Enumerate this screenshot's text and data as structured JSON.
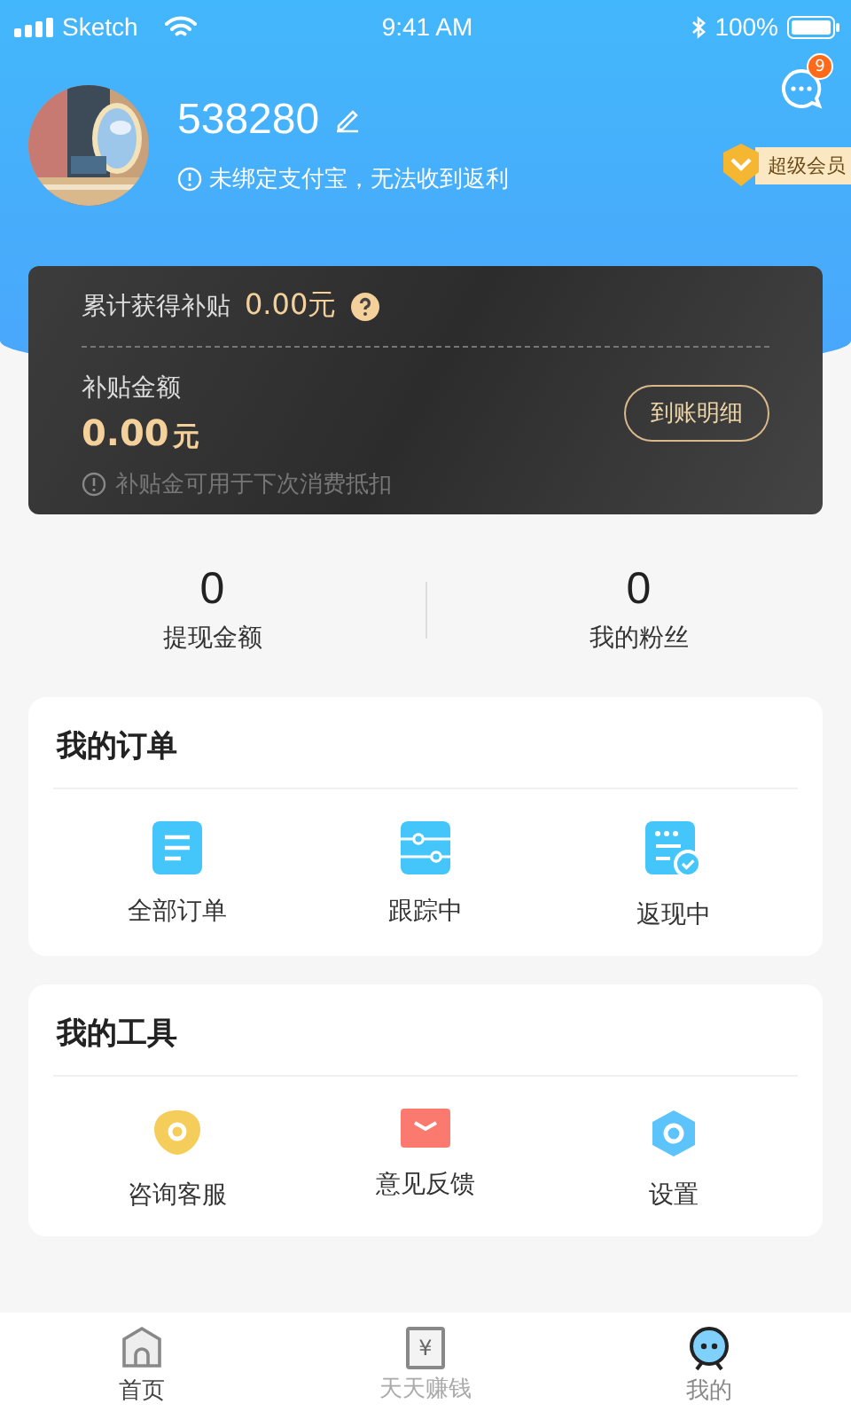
{
  "status_bar": {
    "carrier": "Sketch",
    "time": "9:41 AM",
    "battery": "100%"
  },
  "messages": {
    "badge": "9"
  },
  "profile": {
    "name": "538280",
    "notice": "未绑定支付宝，无法收到返利",
    "vip": "超级会员"
  },
  "subsidy": {
    "total_label": "累计获得补贴",
    "total": "0.00元",
    "amount_label": "补贴金额",
    "amount": "0.00",
    "unit": "元",
    "detail_button": "到账明细",
    "note": "补贴金可用于下次消费抵扣"
  },
  "stats": [
    {
      "value": "0",
      "label": "提现金额"
    },
    {
      "value": "0",
      "label": "我的粉丝"
    }
  ],
  "sections": [
    {
      "title": "我的订单",
      "items": [
        {
          "label": "全部订单",
          "kind": "list"
        },
        {
          "label": "跟踪中",
          "kind": "track"
        },
        {
          "label": "返现中",
          "kind": "cashback"
        }
      ]
    },
    {
      "title": "我的工具",
      "items": [
        {
          "label": "咨询客服",
          "kind": "service"
        },
        {
          "label": "意见反馈",
          "kind": "feedback"
        },
        {
          "label": "设置",
          "kind": "settings"
        }
      ]
    }
  ],
  "tab_bar": [
    {
      "label": "首页",
      "kind": "home",
      "selected": false
    },
    {
      "label": "天天赚钱",
      "kind": "earn",
      "glyph": "¥",
      "selected": false
    },
    {
      "label": "我的",
      "kind": "me",
      "selected": true
    }
  ]
}
